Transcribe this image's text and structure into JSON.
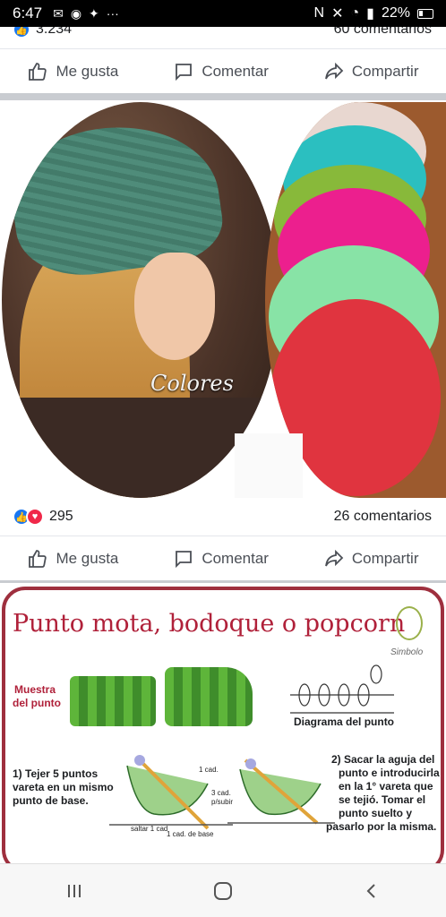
{
  "status": {
    "time": "6:47",
    "battery": "22%"
  },
  "post1": {
    "reactions_count": "3.234",
    "comments": "60 comentarios"
  },
  "actions": {
    "like": "Me gusta",
    "comment": "Comentar",
    "share": "Compartir"
  },
  "post2": {
    "overlay_text": "Colores",
    "reactions_count": "295",
    "comments": "26 comentarios"
  },
  "post3": {
    "title": "Punto mota, bodoque o popcorn",
    "symbol_label": "Simbolo",
    "sample_label_1": "Muestra",
    "sample_label_2": "del punto",
    "diagram_label": "Diagrama del punto",
    "step1_l1": "1) Tejer 5 puntos",
    "step1_l2": "vareta en un mismo",
    "step1_l3": "punto de base.",
    "step2_l1": "2) Sacar la aguja del",
    "step2_l2": "punto e introducirla",
    "step2_l3": "en la 1° vareta que",
    "step2_l4": "se tejió. Tomar el",
    "step2_l5": "punto suelto y",
    "step2_l6": "pasarlo por la misma.",
    "tiny_1cad": "1 cad.",
    "tiny_3cad": "3 cad.",
    "tiny_psubir": "p/subir",
    "tiny_saltar": "saltar 1 cad",
    "tiny_1cadbase": "1 cad. de base"
  },
  "colors": {
    "facebook_blue": "#1877f2",
    "love_red": "#f02849",
    "title_red": "#b0213a",
    "separator": "#c9ccd1"
  }
}
